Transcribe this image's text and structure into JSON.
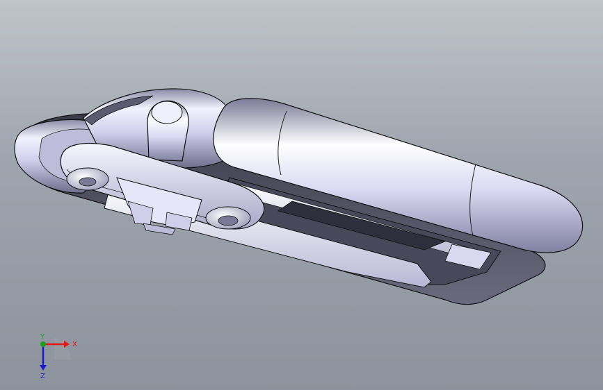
{
  "viewport": {
    "background_top": "#bfc4cb",
    "background_bottom": "#8d939c",
    "part_color": "#d9d9f2",
    "edge_color": "#1a1a1a"
  },
  "triad": {
    "x_label": "X",
    "y_label": "Y",
    "z_label": "Z",
    "x_color": "#e01818",
    "y_color": "#1aa01a",
    "z_color": "#1a1ad0"
  }
}
